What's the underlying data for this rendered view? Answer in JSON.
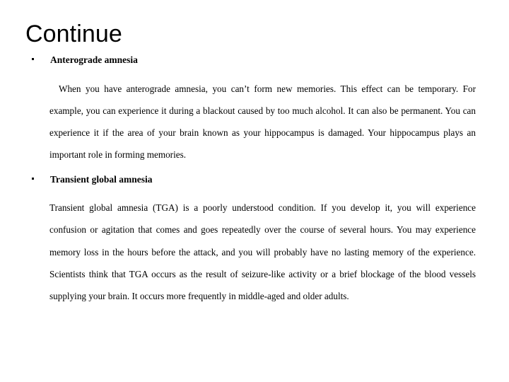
{
  "slide": {
    "title": "Continue",
    "background_color": "#ffffff",
    "text_color": "#000000",
    "bullet_glyph": "square-dot",
    "sections": [
      {
        "heading": "Anterograde amnesia",
        "paragraph": "When you have anterograde amnesia, you can’t form new memories. This effect can be temporary. For example, you can experience it during a blackout caused by too much alcohol. It can also be permanent. You can experience it if the area of your brain known as your hippocampus is damaged. Your hippocampus plays an important role in forming memories.",
        "first_line_indent": true
      },
      {
        "heading": "Transient global amnesia",
        "paragraph": "Transient global amnesia (TGA) is a poorly understood condition. If you develop it, you will experience confusion or agitation that comes and goes repeatedly over the course of several hours. You may experience memory loss in the hours before the attack, and you will probably have no lasting memory of the experience. Scientists think that TGA occurs as the result of seizure-like activity or a brief blockage of the blood vessels supplying your brain. It occurs more frequently in middle-aged and older adults.",
        "first_line_indent": false
      }
    ]
  }
}
